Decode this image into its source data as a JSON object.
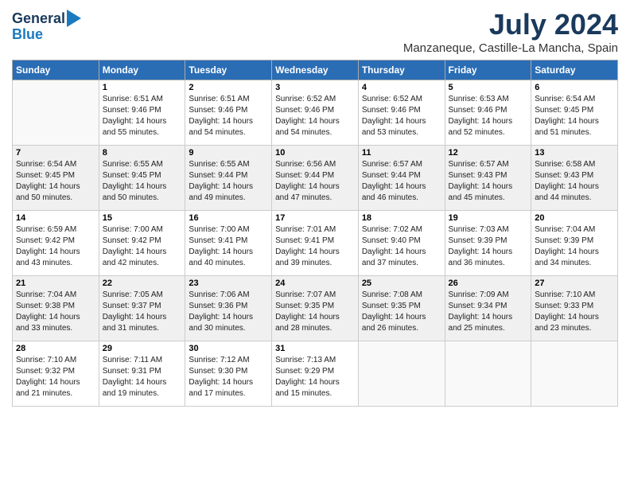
{
  "logo": {
    "line1": "General",
    "line2": "Blue"
  },
  "title": "July 2024",
  "subtitle": "Manzaneque, Castille-La Mancha, Spain",
  "weekdays": [
    "Sunday",
    "Monday",
    "Tuesday",
    "Wednesday",
    "Thursday",
    "Friday",
    "Saturday"
  ],
  "weeks": [
    [
      {
        "num": "",
        "info": ""
      },
      {
        "num": "1",
        "info": "Sunrise: 6:51 AM\nSunset: 9:46 PM\nDaylight: 14 hours\nand 55 minutes."
      },
      {
        "num": "2",
        "info": "Sunrise: 6:51 AM\nSunset: 9:46 PM\nDaylight: 14 hours\nand 54 minutes."
      },
      {
        "num": "3",
        "info": "Sunrise: 6:52 AM\nSunset: 9:46 PM\nDaylight: 14 hours\nand 54 minutes."
      },
      {
        "num": "4",
        "info": "Sunrise: 6:52 AM\nSunset: 9:46 PM\nDaylight: 14 hours\nand 53 minutes."
      },
      {
        "num": "5",
        "info": "Sunrise: 6:53 AM\nSunset: 9:46 PM\nDaylight: 14 hours\nand 52 minutes."
      },
      {
        "num": "6",
        "info": "Sunrise: 6:54 AM\nSunset: 9:45 PM\nDaylight: 14 hours\nand 51 minutes."
      }
    ],
    [
      {
        "num": "7",
        "info": "Sunrise: 6:54 AM\nSunset: 9:45 PM\nDaylight: 14 hours\nand 50 minutes."
      },
      {
        "num": "8",
        "info": "Sunrise: 6:55 AM\nSunset: 9:45 PM\nDaylight: 14 hours\nand 50 minutes."
      },
      {
        "num": "9",
        "info": "Sunrise: 6:55 AM\nSunset: 9:44 PM\nDaylight: 14 hours\nand 49 minutes."
      },
      {
        "num": "10",
        "info": "Sunrise: 6:56 AM\nSunset: 9:44 PM\nDaylight: 14 hours\nand 47 minutes."
      },
      {
        "num": "11",
        "info": "Sunrise: 6:57 AM\nSunset: 9:44 PM\nDaylight: 14 hours\nand 46 minutes."
      },
      {
        "num": "12",
        "info": "Sunrise: 6:57 AM\nSunset: 9:43 PM\nDaylight: 14 hours\nand 45 minutes."
      },
      {
        "num": "13",
        "info": "Sunrise: 6:58 AM\nSunset: 9:43 PM\nDaylight: 14 hours\nand 44 minutes."
      }
    ],
    [
      {
        "num": "14",
        "info": "Sunrise: 6:59 AM\nSunset: 9:42 PM\nDaylight: 14 hours\nand 43 minutes."
      },
      {
        "num": "15",
        "info": "Sunrise: 7:00 AM\nSunset: 9:42 PM\nDaylight: 14 hours\nand 42 minutes."
      },
      {
        "num": "16",
        "info": "Sunrise: 7:00 AM\nSunset: 9:41 PM\nDaylight: 14 hours\nand 40 minutes."
      },
      {
        "num": "17",
        "info": "Sunrise: 7:01 AM\nSunset: 9:41 PM\nDaylight: 14 hours\nand 39 minutes."
      },
      {
        "num": "18",
        "info": "Sunrise: 7:02 AM\nSunset: 9:40 PM\nDaylight: 14 hours\nand 37 minutes."
      },
      {
        "num": "19",
        "info": "Sunrise: 7:03 AM\nSunset: 9:39 PM\nDaylight: 14 hours\nand 36 minutes."
      },
      {
        "num": "20",
        "info": "Sunrise: 7:04 AM\nSunset: 9:39 PM\nDaylight: 14 hours\nand 34 minutes."
      }
    ],
    [
      {
        "num": "21",
        "info": "Sunrise: 7:04 AM\nSunset: 9:38 PM\nDaylight: 14 hours\nand 33 minutes."
      },
      {
        "num": "22",
        "info": "Sunrise: 7:05 AM\nSunset: 9:37 PM\nDaylight: 14 hours\nand 31 minutes."
      },
      {
        "num": "23",
        "info": "Sunrise: 7:06 AM\nSunset: 9:36 PM\nDaylight: 14 hours\nand 30 minutes."
      },
      {
        "num": "24",
        "info": "Sunrise: 7:07 AM\nSunset: 9:35 PM\nDaylight: 14 hours\nand 28 minutes."
      },
      {
        "num": "25",
        "info": "Sunrise: 7:08 AM\nSunset: 9:35 PM\nDaylight: 14 hours\nand 26 minutes."
      },
      {
        "num": "26",
        "info": "Sunrise: 7:09 AM\nSunset: 9:34 PM\nDaylight: 14 hours\nand 25 minutes."
      },
      {
        "num": "27",
        "info": "Sunrise: 7:10 AM\nSunset: 9:33 PM\nDaylight: 14 hours\nand 23 minutes."
      }
    ],
    [
      {
        "num": "28",
        "info": "Sunrise: 7:10 AM\nSunset: 9:32 PM\nDaylight: 14 hours\nand 21 minutes."
      },
      {
        "num": "29",
        "info": "Sunrise: 7:11 AM\nSunset: 9:31 PM\nDaylight: 14 hours\nand 19 minutes."
      },
      {
        "num": "30",
        "info": "Sunrise: 7:12 AM\nSunset: 9:30 PM\nDaylight: 14 hours\nand 17 minutes."
      },
      {
        "num": "31",
        "info": "Sunrise: 7:13 AM\nSunset: 9:29 PM\nDaylight: 14 hours\nand 15 minutes."
      },
      {
        "num": "",
        "info": ""
      },
      {
        "num": "",
        "info": ""
      },
      {
        "num": "",
        "info": ""
      }
    ]
  ]
}
